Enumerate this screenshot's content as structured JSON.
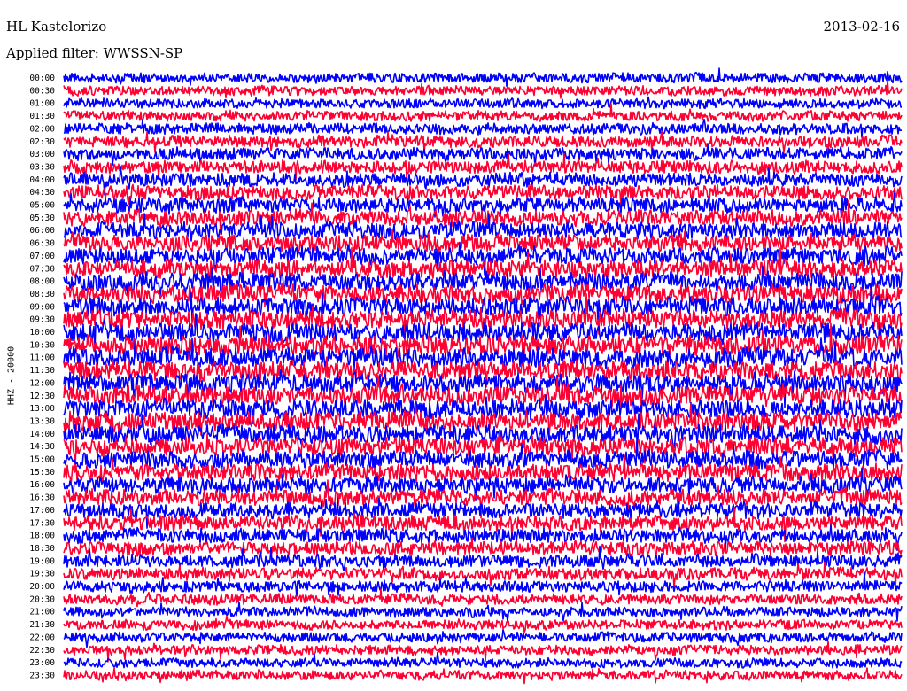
{
  "header": {
    "station": "HL Kastelorizo",
    "date": "2013-02-16",
    "filter": "Applied filter: WWSSN-SP"
  },
  "chart_data": {
    "type": "line",
    "title": "HL Kastelorizo",
    "ylabel": "HHZ - 20000",
    "y_tick_labels": [
      "00:00",
      "00:30",
      "01:00",
      "01:30",
      "02:00",
      "02:30",
      "03:00",
      "03:30",
      "04:00",
      "04:30",
      "05:00",
      "05:30",
      "06:00",
      "06:30",
      "07:00",
      "07:30",
      "08:00",
      "08:30",
      "09:00",
      "09:30",
      "10:00",
      "10:30",
      "11:00",
      "11:30",
      "12:00",
      "12:30",
      "13:00",
      "13:30",
      "14:00",
      "14:30",
      "15:00",
      "15:30",
      "16:00",
      "16:30",
      "17:00",
      "17:30",
      "18:00",
      "18:30",
      "19:00",
      "19:30",
      "20:00",
      "20:30",
      "21:00",
      "21:30",
      "22:00",
      "22:30",
      "23:00",
      "23:30"
    ],
    "trace_colors": [
      "#0000ff",
      "#ff0033"
    ],
    "grid": false,
    "legend": "none"
  }
}
